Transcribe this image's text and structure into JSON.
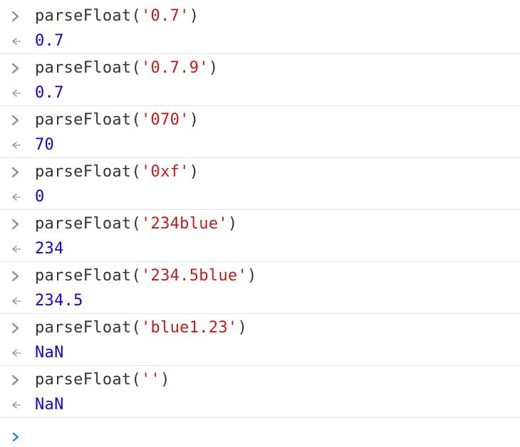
{
  "console": {
    "entries": [
      {
        "fn": "parseFloat",
        "arg": "'0.7'",
        "result": "0.7"
      },
      {
        "fn": "parseFloat",
        "arg": "'0.7.9'",
        "result": "0.7"
      },
      {
        "fn": "parseFloat",
        "arg": "'070'",
        "result": "70"
      },
      {
        "fn": "parseFloat",
        "arg": "'0xf'",
        "result": "0"
      },
      {
        "fn": "parseFloat",
        "arg": "'234blue'",
        "result": "234"
      },
      {
        "fn": "parseFloat",
        "arg": "'234.5blue'",
        "result": "234.5"
      },
      {
        "fn": "parseFloat",
        "arg": "'blue1.23'",
        "result": "NaN"
      },
      {
        "fn": "parseFloat",
        "arg": "''",
        "result": "NaN"
      }
    ],
    "open_paren": "(",
    "close_paren": ")",
    "icons": {
      "input": "chevron-right-icon",
      "output": "return-arrow-icon",
      "prompt": "prompt-chevron-icon"
    },
    "colors": {
      "function": "#333333",
      "string": "#c41a16",
      "result": "#1c00cf",
      "prompt": "#2a7ff1",
      "gutter": "#8a8a8a",
      "divider": "#e3e3e3"
    }
  }
}
